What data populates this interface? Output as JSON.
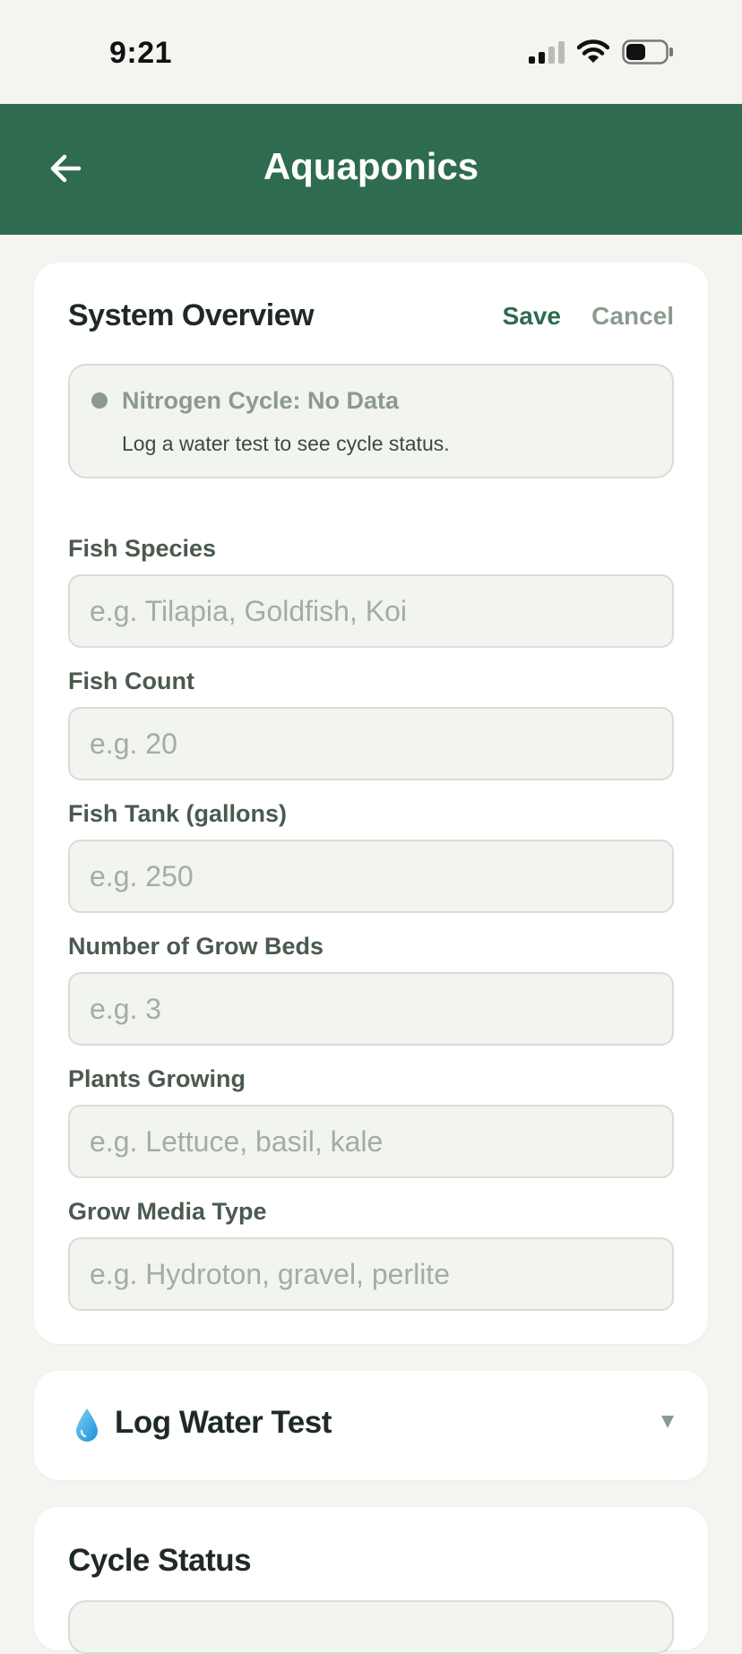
{
  "status_bar": {
    "time": "9:21"
  },
  "header": {
    "title": "Aquaponics"
  },
  "overview": {
    "title": "System Overview",
    "save_label": "Save",
    "cancel_label": "Cancel",
    "cycle": {
      "title": "Nitrogen Cycle: No Data",
      "subtitle": "Log a water test to see cycle status."
    },
    "fields": [
      {
        "label": "Fish Species",
        "placeholder": "e.g. Tilapia, Goldfish, Koi",
        "value": ""
      },
      {
        "label": "Fish Count",
        "placeholder": "e.g. 20",
        "value": ""
      },
      {
        "label": "Fish Tank (gallons)",
        "placeholder": "e.g. 250",
        "value": ""
      },
      {
        "label": "Number of Grow Beds",
        "placeholder": "e.g. 3",
        "value": ""
      },
      {
        "label": "Plants Growing",
        "placeholder": "e.g. Lettuce, basil, kale",
        "value": ""
      },
      {
        "label": "Grow Media Type",
        "placeholder": "e.g. Hydroton, gravel, perlite",
        "value": ""
      }
    ]
  },
  "water_test": {
    "title": "Log Water Test",
    "icon": "water-drop-icon",
    "expanded": false
  },
  "cycle_status": {
    "title": "Cycle Status"
  },
  "colors": {
    "header": "#2e6b4f",
    "accent": "#2e6b4f",
    "muted": "#8c9a8e",
    "background": "#f4f5f0"
  }
}
